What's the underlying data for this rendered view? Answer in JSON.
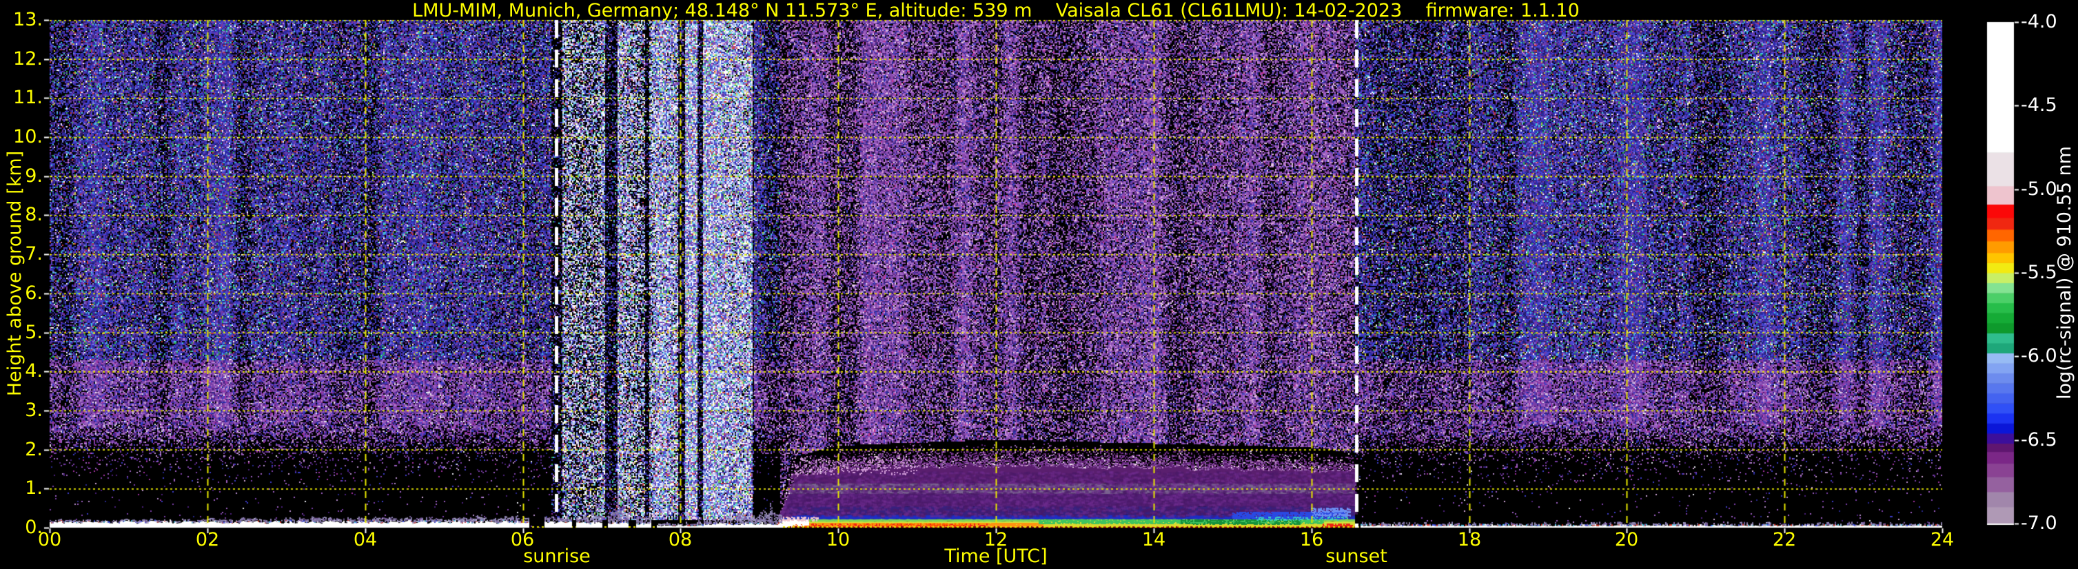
{
  "title": {
    "text": "LMU-MIM, Munich, Germany; 48.148° N 11.573° E, altitude: 539 m    Vaisala CL61 (CL61LMU): 14-02-2023    firmware: 1.1.10",
    "color": "#fdfd00"
  },
  "axes": {
    "x": {
      "label": "Time [UTC]",
      "range_hours": [
        0,
        24
      ],
      "ticks": [
        "00",
        "02",
        "04",
        "06",
        "08",
        "10",
        "12",
        "14",
        "16",
        "18",
        "20",
        "22",
        "24"
      ]
    },
    "y": {
      "label": "Height above ground [km]",
      "range_km": [
        0,
        13
      ],
      "ticks": [
        "0.",
        "1.",
        "2.",
        "3.",
        "4.",
        "5.",
        "6.",
        "7.",
        "8.",
        "9.",
        "10.",
        "11.",
        "12.",
        "13."
      ]
    }
  },
  "colorbar": {
    "label": "log(rc-signal) @ 910.55 nm",
    "ticks": [
      "-4.0",
      "-4.5",
      "-5.0",
      "-5.5",
      "-6.0",
      "-6.5",
      "-7.0"
    ],
    "range": [
      -7.0,
      -4.0
    ]
  },
  "annotations": {
    "sunrise": {
      "label": "sunrise",
      "time_utc": 6.42
    },
    "sunset": {
      "label": "sunset",
      "time_utc": 16.57
    }
  },
  "chart_data": {
    "type": "heatmap",
    "title": "LMU-MIM, Munich, Germany; 48.148° N 11.573° E, altitude: 539 m    Vaisala CL61 (CL61LMU): 14-02-2023    firmware: 1.1.10",
    "x": {
      "label": "Time [UTC]",
      "range_hours": [
        0,
        24
      ],
      "tick_step_hours": 2
    },
    "y": {
      "label": "Height above ground [km]",
      "range_km": [
        0,
        13
      ],
      "tick_step_km": 1
    },
    "z": {
      "label": "log(rc-signal) @ 910.55 nm",
      "range": [
        -7.0,
        -4.0
      ],
      "tick_step": 0.5
    },
    "grid": {
      "color": "#e8e800",
      "h_lines_km": [
        0,
        1,
        2,
        3,
        4,
        5,
        6,
        7,
        8,
        9,
        10,
        11,
        12,
        13
      ],
      "v_lines_hours": [
        2,
        4,
        6,
        8,
        10,
        12,
        14,
        16,
        18,
        20,
        22
      ]
    },
    "sunrise_utc": 6.42,
    "sunset_utc": 16.57,
    "colormap_stops": [
      [
        -7.0,
        -6.9,
        "#af99b5"
      ],
      [
        -6.9,
        -6.81,
        "#a186ab"
      ],
      [
        -6.81,
        -6.72,
        "#95619f"
      ],
      [
        -6.72,
        -6.64,
        "#8a4293"
      ],
      [
        -6.64,
        -6.57,
        "#7b2787"
      ],
      [
        -6.57,
        -6.52,
        "#5f1670"
      ],
      [
        -6.52,
        -6.46,
        "#3c0f9b"
      ],
      [
        -6.46,
        -6.4,
        "#0b16d8"
      ],
      [
        -6.4,
        -6.34,
        "#1c33f2"
      ],
      [
        -6.34,
        -6.28,
        "#3050f6"
      ],
      [
        -6.28,
        -6.22,
        "#4463f0"
      ],
      [
        -6.22,
        -6.16,
        "#5877ee"
      ],
      [
        -6.16,
        -6.1,
        "#6d8cee"
      ],
      [
        -6.1,
        -6.04,
        "#83a4f2"
      ],
      [
        -6.04,
        -5.98,
        "#97bbf4"
      ],
      [
        -5.98,
        -5.92,
        "#1ea77a"
      ],
      [
        -5.92,
        -5.86,
        "#2fbd8d"
      ],
      [
        -5.86,
        -5.8,
        "#0e9a2c"
      ],
      [
        -5.8,
        -5.74,
        "#15ab36"
      ],
      [
        -5.74,
        -5.68,
        "#27bd4a"
      ],
      [
        -5.68,
        -5.62,
        "#4ccf68"
      ],
      [
        -5.62,
        -5.56,
        "#84e392"
      ],
      [
        -5.56,
        -5.5,
        "#c8ef66"
      ],
      [
        -5.5,
        -5.44,
        "#f2ea12"
      ],
      [
        -5.44,
        -5.38,
        "#ffc400"
      ],
      [
        -5.38,
        -5.31,
        "#ff9b00"
      ],
      [
        -5.31,
        -5.24,
        "#ff6600"
      ],
      [
        -5.24,
        -5.17,
        "#f02711"
      ],
      [
        -5.17,
        -5.09,
        "#fb0808"
      ],
      [
        -5.09,
        -4.98,
        "#eec4ce"
      ],
      [
        -4.98,
        -4.78,
        "#ebe1e6"
      ],
      [
        -4.78,
        -4.0,
        "#ffffff"
      ]
    ],
    "background_noise": {
      "night_profile": [
        [
          0,
          0.012
        ],
        [
          1.1,
          0.02
        ],
        [
          1.9,
          0.12
        ],
        [
          2.7,
          0.8
        ],
        [
          13,
          0.8
        ]
      ],
      "day_above_layer": 0.7,
      "columns_region": [
        6.35,
        8.92
      ],
      "columns_bright": 0.85,
      "columns_gap": 0.3,
      "palettes": {
        "blue": [
          [
            "#2b2ba6",
            24
          ],
          [
            "#4545d2",
            20
          ],
          [
            "#6f3aa8",
            17
          ],
          [
            "#3a1f72",
            10
          ],
          [
            "#1d1d5e",
            8
          ],
          [
            "#7d7de2",
            5
          ],
          [
            "#40c8d8",
            4
          ],
          [
            "#2fae4e",
            3
          ],
          [
            "#c23535",
            2
          ],
          [
            "#c8c83a",
            2
          ],
          [
            "#cc86c8",
            2
          ],
          [
            "#ffffff",
            2
          ],
          [
            "#8c2a96",
            1
          ]
        ],
        "purple": [
          [
            "#7a3fa8",
            30
          ],
          [
            "#9b5fc0",
            20
          ],
          [
            "#b58ccc",
            8
          ],
          [
            "#4a1f7a",
            14
          ],
          [
            "#3c3cc8",
            9
          ],
          [
            "#28288c",
            6
          ],
          [
            "#a030a0",
            5
          ],
          [
            "#d0a8d8",
            3
          ],
          [
            "#e8e8f0",
            2
          ]
        ],
        "bright": [
          [
            "#ffffff",
            16
          ],
          [
            "#c8d4f4",
            14
          ],
          [
            "#96acec",
            12
          ],
          [
            "#66d8e8",
            7
          ],
          [
            "#4a5ad8",
            12
          ],
          [
            "#8a4fb0",
            10
          ],
          [
            "#4ec96a",
            5
          ],
          [
            "#d8d855",
            4
          ],
          [
            "#d84040",
            3
          ],
          [
            "#e0a8d8",
            5
          ],
          [
            "#3030a8",
            8
          ],
          [
            "#6f3aa8",
            6
          ]
        ],
        "daypurple": [
          [
            "#8a4aae",
            28
          ],
          [
            "#a368c8",
            20
          ],
          [
            "#cf9ad6",
            7
          ],
          [
            "#56267e",
            14
          ],
          [
            "#4040c0",
            8
          ],
          [
            "#2c2c90",
            5
          ],
          [
            "#e8d0e8",
            3
          ],
          [
            "#c83290",
            2
          ],
          [
            "#3a1f72",
            6
          ]
        ],
        "haze": [
          [
            "#5c2070",
            38
          ],
          [
            "#7a3a96",
            30
          ],
          [
            "#9a6ab0",
            18
          ],
          [
            "#c890c8",
            8
          ],
          [
            "#efe0ef",
            4
          ]
        ],
        "nightfuzz": [
          [
            "#9186b8",
            50
          ],
          [
            "#7a5f9e",
            30
          ],
          [
            "#b0a8cc",
            20
          ]
        ]
      }
    },
    "daylight_noise_columns": [
      [
        6.5,
        7.03
      ],
      [
        7.2,
        7.55
      ],
      [
        7.6,
        7.97
      ],
      [
        8.05,
        8.2
      ],
      [
        8.27,
        8.9
      ]
    ],
    "nocturnal_layer": {
      "fringe_colors": [
        "#55ccee",
        "#dd3322",
        "#4455ee",
        "#b8a8d8",
        "#ffffff"
      ],
      "segments": [
        {
          "t0": 0,
          "t1": 6.07,
          "w": 0.14,
          "f0": 0.01,
          "f1": 0.1
        },
        {
          "t0": 6.28,
          "t1": 6.62,
          "w": 0.13,
          "f0": 0.1,
          "f1": 0.12
        },
        {
          "t0": 6.68,
          "t1": 7.0,
          "w": 0.12,
          "f0": 0.18,
          "f1": 0.2
        },
        {
          "t0": 7.08,
          "t1": 7.34,
          "w": 0.12,
          "f0": 0.22,
          "f1": 0.2
        },
        {
          "t0": 7.44,
          "t1": 7.62,
          "w": 0.1,
          "f0": 0.16,
          "f1": 0.14
        },
        {
          "t0": 7.7,
          "t1": 8.3,
          "w": 0.05,
          "f0": 0.02,
          "f1": 0.03
        },
        {
          "t0": 8.3,
          "t1": 9.28,
          "w": 0.09,
          "f0": 0.1,
          "f1": 0.3
        }
      ]
    },
    "daytime_layer": {
      "t": [
        9.25,
        16.55
      ],
      "haze_top_km": [
        [
          9.25,
          0.4
        ],
        [
          9.4,
          1.7
        ],
        [
          10,
          2.0
        ],
        [
          12,
          2.15
        ],
        [
          14,
          2.05
        ],
        [
          16,
          1.95
        ],
        [
          16.55,
          1.8
        ]
      ],
      "solid_top_km": [
        [
          9.25,
          0.3
        ],
        [
          9.45,
          1.3
        ],
        [
          10,
          1.5
        ],
        [
          12,
          1.6
        ],
        [
          14,
          1.55
        ],
        [
          16.55,
          1.45
        ]
      ],
      "bands": [
        {
          "h0": 0,
          "h1": 0.03,
          "c": "#c11212"
        },
        {
          "h0": 0.03,
          "h1": 0.105,
          "c": "#ded82e"
        },
        {
          "h0": 0.105,
          "h1": 0.165,
          "c": "#cfe23c"
        },
        {
          "h0": 0.165,
          "h1": 0.225,
          "c": "#7ed45a"
        },
        {
          "h0": 0.225,
          "h1": 0.33,
          "c": "#1e2cc4"
        },
        {
          "h0": 0.33,
          "h1": 0.55,
          "c": "#37217f"
        },
        {
          "h0": 0.55,
          "h1": 0.88,
          "c": "#531f76"
        },
        {
          "h0": 0.88,
          "h1": 1.14,
          "c": "#79618f"
        },
        {
          "h0": 1.14,
          "h1": 9,
          "c": "#5a1f6e"
        }
      ],
      "patches": [
        {
          "t": [
            9.32,
            12.6
          ],
          "h": [
            0.03,
            0.115
          ],
          "c": "#ff9210",
          "d": 0.85
        },
        {
          "t": [
            9.35,
            11.9
          ],
          "h": [
            0.04,
            0.1
          ],
          "c": "#ee2414",
          "d": 0.3
        },
        {
          "t": [
            10.1,
            11.6
          ],
          "h": [
            0.05,
            0.1
          ],
          "c": "#ff5a00",
          "d": 0.3
        },
        {
          "t": [
            12.55,
            16.15
          ],
          "h": [
            0.1,
            0.21
          ],
          "c": "#3fc45e",
          "d": 0.65
        },
        {
          "t": [
            14.35,
            15.85
          ],
          "h": [
            0.09,
            0.19
          ],
          "c": "#14913a",
          "d": 0.5
        },
        {
          "t": [
            15.0,
            16.42
          ],
          "h": [
            0.23,
            0.4
          ],
          "c": "#2a49e2",
          "d": 0.75
        },
        {
          "t": [
            16.0,
            16.5
          ],
          "h": [
            0.3,
            0.52
          ],
          "c": "#6b8ef2",
          "d": 0.5
        },
        {
          "t": [
            15.3,
            16.45
          ],
          "h": [
            0.2,
            0.27
          ],
          "c": "#3ad0c0",
          "d": 0.3
        },
        {
          "t": [
            16.15,
            16.52
          ],
          "h": [
            0,
            0.09
          ],
          "c": "#ee2414",
          "d": 0.75
        },
        {
          "t": [
            9.25,
            9.62
          ],
          "h": [
            0,
            0.2
          ],
          "c": "#ffffff",
          "d": 0.92
        },
        {
          "t": [
            9.25,
            9.75
          ],
          "h": [
            0.17,
            0.28
          ],
          "c": "#eec4ce",
          "d": 0.45
        },
        {
          "t": [
            9.42,
            9.85
          ],
          "h": [
            0,
            0.05
          ],
          "c": "#ff5a00",
          "d": 0.7
        },
        {
          "t": [
            9.3,
            16.5
          ],
          "h": [
            0,
            0.025
          ],
          "c": "#7c0d0d",
          "d": 0.3
        },
        {
          "t": [
            9.4,
            11.0
          ],
          "h": [
            1.35,
            1.8
          ],
          "c": "#cf9ad6",
          "d": 0.1
        }
      ]
    },
    "post_sunset_layer": {
      "t0": 16.63,
      "t1": 24,
      "w": 0.05,
      "f": 0.05
    }
  }
}
